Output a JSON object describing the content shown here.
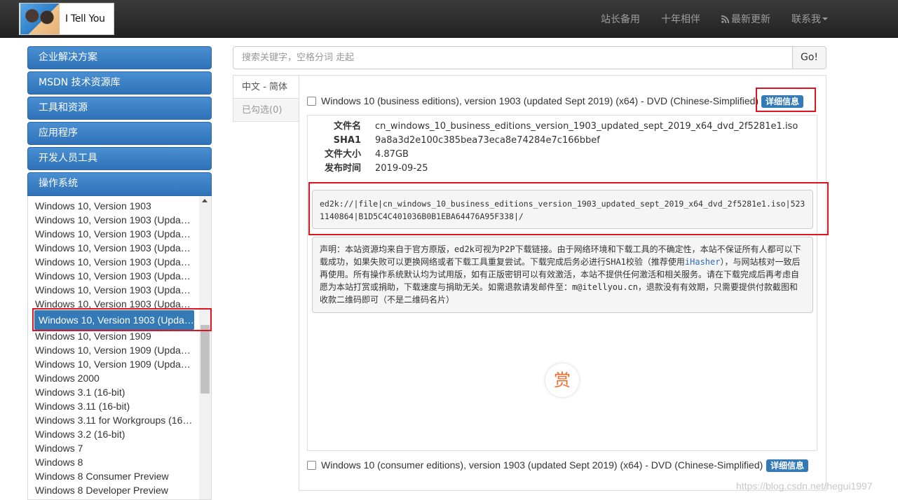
{
  "navbar": {
    "brand": "I Tell You",
    "links": [
      "站长备用",
      "十年相伴",
      "最新更新",
      "联系我"
    ]
  },
  "sidebar": {
    "categories": [
      "企业解决方案",
      "MSDN 技术资源库",
      "工具和资源",
      "应用程序",
      "开发人员工具",
      "操作系统"
    ],
    "os_items": [
      "Windows 10, Version 1903",
      "Windows 10, Version 1903 (Updated...",
      "Windows 10, Version 1903 (Updated...",
      "Windows 10, Version 1903 (Updated...",
      "Windows 10, Version 1903 (Updated...",
      "Windows 10, Version 1903 (Updated...",
      "Windows 10, Version 1903 (Updated...",
      "Windows 10, Version 1903 (Updated...",
      "Windows 10, Version 1903 (Updated...",
      "Windows 10, Version 1909",
      "Windows 10, Version 1909 (Updated...",
      "Windows 10, Version 1909 (Updated...",
      "Windows 2000",
      "Windows 3.1 (16-bit)",
      "Windows 3.11 (16-bit)",
      "Windows 3.11 for Workgroups (16-bit)",
      "Windows 3.2 (16-bit)",
      "Windows 7",
      "Windows 8",
      "Windows 8 Consumer Preview",
      "Windows 8 Developer Preview"
    ]
  },
  "search": {
    "placeholder": "搜索关键字，空格分词 走起",
    "button": "Go!"
  },
  "tabs": {
    "active": "中文 - 简体",
    "selected": "已勾选(0)"
  },
  "items": [
    {
      "title": "Windows 10 (business editions), version 1903 (updated Sept 2019) (x64) - DVD (Chinese-Simplified)",
      "button": "详细信息"
    },
    {
      "title": "Windows 10 (consumer editions), version 1903 (updated Sept 2019) (x64) - DVD (Chinese-Simplified)",
      "button": "详细信息"
    }
  ],
  "detail": {
    "filename_key": "文件名",
    "filename": "cn_windows_10_business_editions_version_1903_updated_sept_2019_x64_dvd_2f5281e1.iso",
    "sha1_key": "SHA1",
    "sha1": "9a8a3d2e100c385bea73eca8e74284e7c166bbef",
    "size_key": "文件大小",
    "size": "4.87GB",
    "date_key": "发布时间",
    "date": "2019-09-25",
    "ed2k": "ed2k://|file|cn_windows_10_business_editions_version_1903_updated_sept_2019_x64_dvd_2f5281e1.iso|5231140864|B1D5C4C401036B0B1EBA64476A95F338|/",
    "notice_1": "声明：本站资源均来自于官方原版，ed2k可视为P2P下载链接。由于网络环境和下载工具的不确定性，本站不保证所有人都可以下载成功，如果失败可以更换网络或者下载工具重复尝试。下载完成后务必进行SHA1校验（推荐使用",
    "notice_link": "iHasher",
    "notice_2": "），与网站核对一致后再使用。所有操作系统默认均为试用版，如有正版密钥可以有效激活，本站不提供任何激活和相关服务。请在下载完成后再考虑自愿为本站打赏或捐助，下载速度与捐助无关。如需退款请发邮件至：m@itellyou.cn，退款没有有效期，只需要提供付款截图和收款二维码即可（不是二维码名片）",
    "reward": "赏"
  },
  "watermark": "https://blog.csdn.net/hegui1997"
}
